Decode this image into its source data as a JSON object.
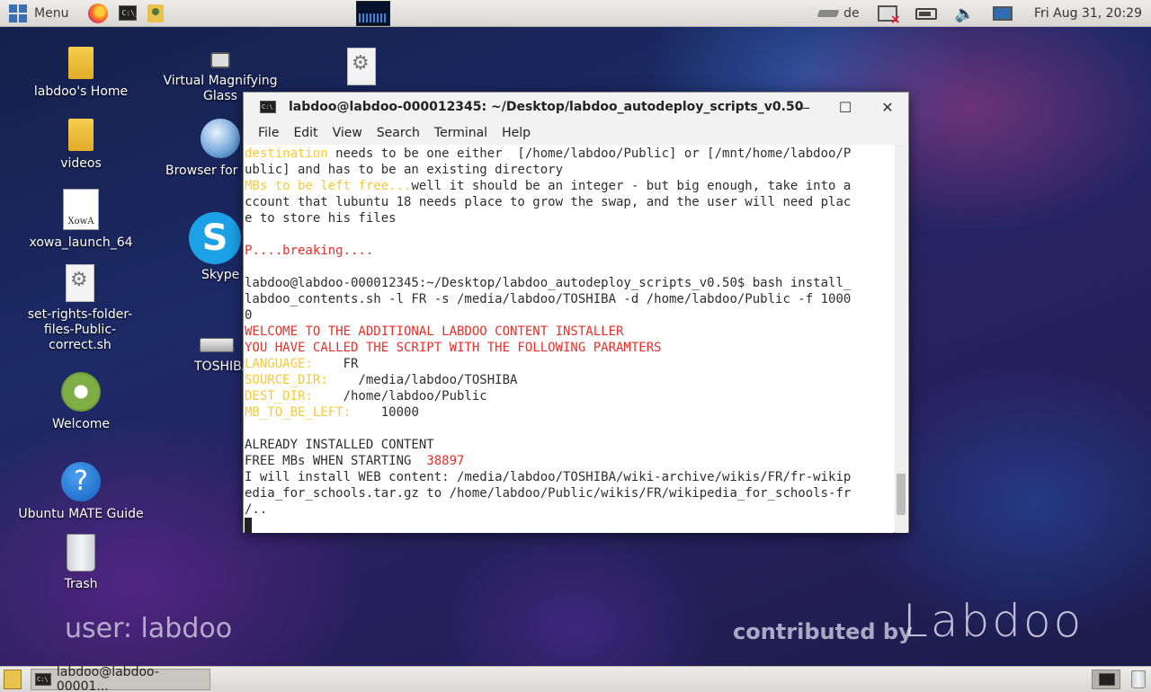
{
  "top_panel": {
    "menu_label": "Menu",
    "keyboard_layout": "de",
    "clock": "Fri Aug 31, 20:29"
  },
  "desktop": {
    "icons": [
      {
        "label": "labdoo's Home"
      },
      {
        "label": "Virtual Magnifying Glass"
      },
      {
        "label": "videos"
      },
      {
        "label": "Browser for"
      },
      {
        "label": "xowa_launch_64"
      },
      {
        "label": "Skype"
      },
      {
        "label": "set-rights-folder-files-Public-correct.sh"
      },
      {
        "label": "TOSHIBA"
      },
      {
        "label": "Welcome"
      },
      {
        "label": "Ubuntu MATE Guide"
      },
      {
        "label": "Trash"
      }
    ],
    "xowa_icon_text": "XowA",
    "user_label": "user: labdoo",
    "contributed": "contributed by",
    "logo": "Labdoo"
  },
  "terminal": {
    "title": "labdoo@labdoo-000012345: ~/Desktop/labdoo_autodeploy_scripts_v0.50",
    "menu": [
      "File",
      "Edit",
      "View",
      "Search",
      "Terminal",
      "Help"
    ],
    "lines": {
      "l1a": "destination",
      "l1b": " needs to be one either  [/home/labdoo/Public] or [/mnt/home/labdoo/P",
      "l2": "ublic] and has to be an existing directory",
      "l3a": "MBs to be left free...",
      "l3b": "well it should be an integer - but big enough, take into a",
      "l4": "ccount that lubuntu 18 needs place to grow the swap, and the user will need plac",
      "l5": "e to store his files",
      "l6": "",
      "l7": "P....breaking....",
      "l8": "",
      "l9": "labdoo@labdoo-000012345:~/Desktop/labdoo_autodeploy_scripts_v0.50$ bash install_",
      "l10": "labdoo_contents.sh -l FR -s /media/labdoo/TOSHIBA -d /home/labdoo/Public -f 1000",
      "l11": "0",
      "l12": "WELCOME TO THE ADDITIONAL LABDOO CONTENT INSTALLER",
      "l13": "YOU HAVE CALLED THE SCRIPT WITH THE FOLLOWING PARAMTERS",
      "l14a": "LANGUAGE:",
      "l14b": "    FR",
      "l15a": "SOURCE_DIR:",
      "l15b": "    /media/labdoo/TOSHIBA",
      "l16a": "DEST_DIR:",
      "l16b": "    /home/labdoo/Public",
      "l17a": "MB_TO_BE_LEFT:",
      "l17b": "    10000",
      "l18": "",
      "l19": "ALREADY INSTALLED CONTENT",
      "l20a": "FREE MBs WHEN STARTING  ",
      "l20b": "38897",
      "l21": "I will install WEB content: /media/labdoo/TOSHIBA/wiki-archive/wikis/FR/fr-wikip",
      "l22": "edia_for_schools.tar.gz to /home/labdoo/Public/wikis/FR/wikipedia_for_schools-fr",
      "l23": "/.."
    }
  },
  "taskbar": {
    "task_label": "labdoo@labdoo-00001..."
  },
  "colors": {
    "prompt_yellow": "#f5c93b",
    "prompt_red": "#e8302a"
  }
}
